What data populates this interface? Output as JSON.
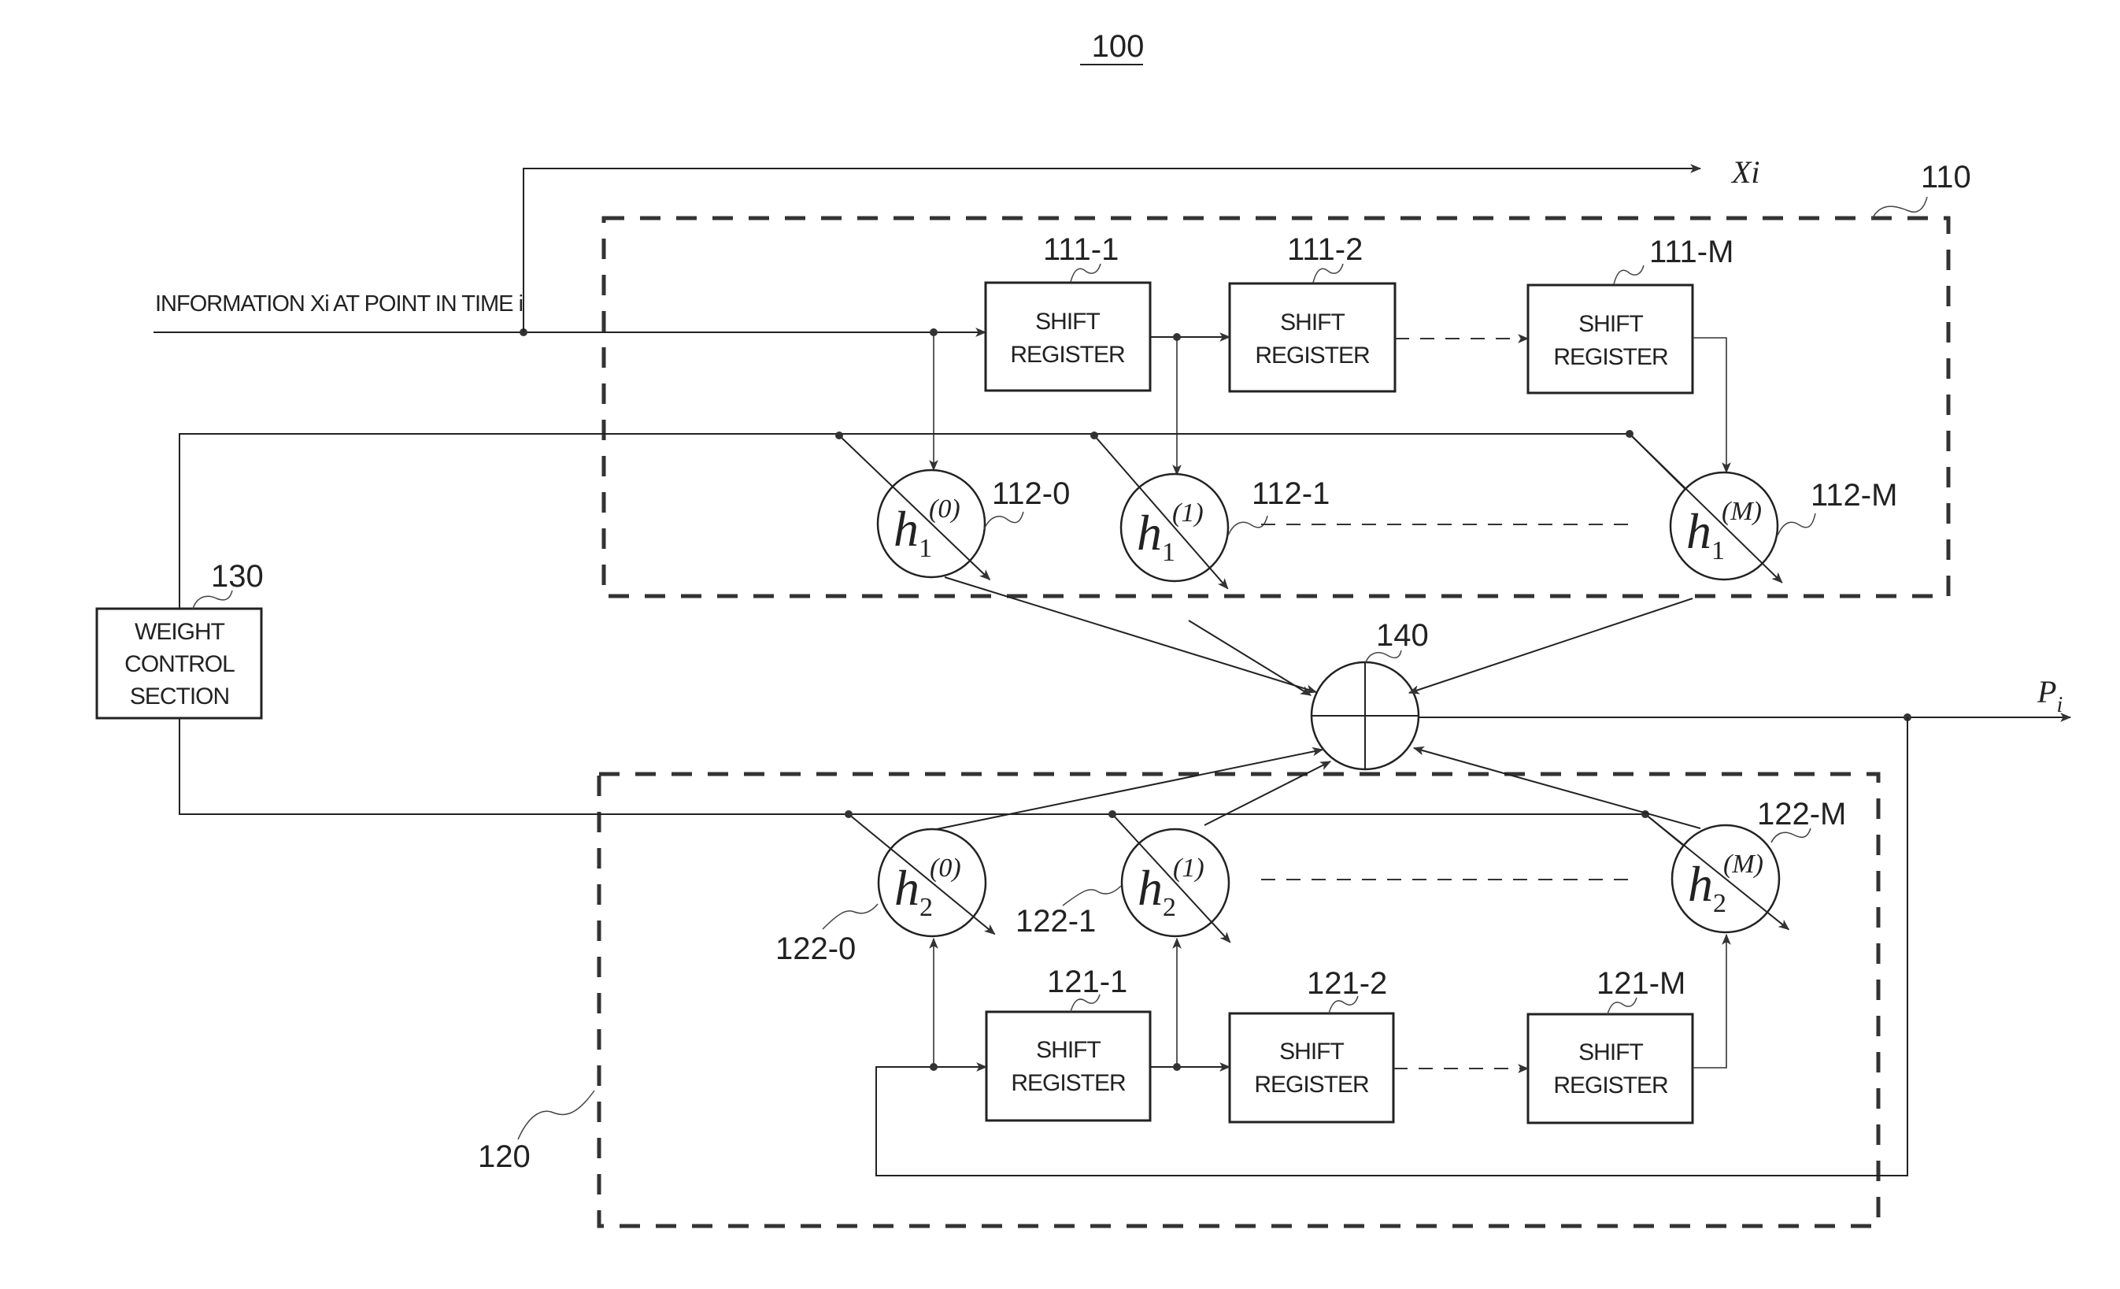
{
  "figure_number": "100",
  "input": {
    "label": "INFORMATION Xi AT POINT IN TIME i",
    "systematic_output_label": "Xi"
  },
  "output": {
    "label": "Pi",
    "label_main": "P",
    "label_sub": "i"
  },
  "sections": {
    "upper": {
      "ref": "110"
    },
    "lower": {
      "ref": "120"
    }
  },
  "weight_control": {
    "ref": "130",
    "lines": [
      "WEIGHT",
      "CONTROL",
      "SECTION"
    ]
  },
  "adder": {
    "ref": "140"
  },
  "upper_registers": [
    {
      "ref": "111-1",
      "line1": "SHIFT",
      "line2": "REGISTER"
    },
    {
      "ref": "111-2",
      "line1": "SHIFT",
      "line2": "REGISTER"
    },
    {
      "ref": "111-M",
      "line1": "SHIFT",
      "line2": "REGISTER"
    }
  ],
  "lower_registers": [
    {
      "ref": "121-1",
      "line1": "SHIFT",
      "line2": "REGISTER"
    },
    {
      "ref": "121-2",
      "line1": "SHIFT",
      "line2": "REGISTER"
    },
    {
      "ref": "121-M",
      "line1": "SHIFT",
      "line2": "REGISTER"
    }
  ],
  "upper_multipliers": [
    {
      "ref": "112-0",
      "base": "h",
      "sub": "1",
      "sup": "(0)"
    },
    {
      "ref": "112-1",
      "base": "h",
      "sub": "1",
      "sup": "(1)"
    },
    {
      "ref": "112-M",
      "base": "h",
      "sub": "1",
      "sup": "(M)"
    }
  ],
  "lower_multipliers": [
    {
      "ref": "122-0",
      "base": "h",
      "sub": "2",
      "sup": "(0)"
    },
    {
      "ref": "122-1",
      "base": "h",
      "sub": "2",
      "sup": "(1)"
    },
    {
      "ref": "122-M",
      "base": "h",
      "sub": "2",
      "sup": "(M)"
    }
  ]
}
